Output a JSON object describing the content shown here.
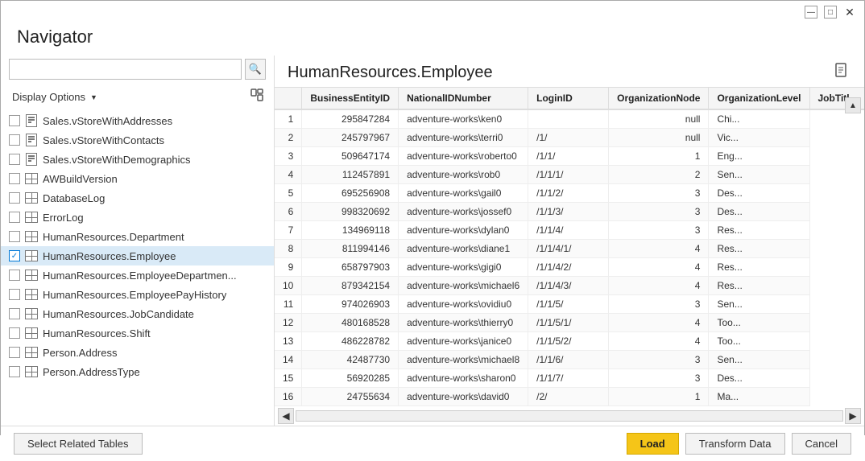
{
  "window": {
    "title": "Navigator"
  },
  "toolbar": {
    "minimize_label": "—",
    "maximize_label": "□",
    "close_label": "✕"
  },
  "left_panel": {
    "search_placeholder": "",
    "display_options_label": "Display Options",
    "display_options_chevron": "▼",
    "refresh_icon": "⟳",
    "items": [
      {
        "name": "Sales.vStoreWithAddresses",
        "type": "view",
        "checked": false
      },
      {
        "name": "Sales.vStoreWithContacts",
        "type": "view",
        "checked": false
      },
      {
        "name": "Sales.vStoreWithDemographics",
        "type": "view",
        "checked": false
      },
      {
        "name": "AWBuildVersion",
        "type": "table",
        "checked": false
      },
      {
        "name": "DatabaseLog",
        "type": "table",
        "checked": false
      },
      {
        "name": "ErrorLog",
        "type": "table",
        "checked": false
      },
      {
        "name": "HumanResources.Department",
        "type": "table",
        "checked": false
      },
      {
        "name": "HumanResources.Employee",
        "type": "table",
        "checked": true,
        "selected": true
      },
      {
        "name": "HumanResources.EmployeeDepartmen...",
        "type": "table",
        "checked": false
      },
      {
        "name": "HumanResources.EmployeePayHistory",
        "type": "table",
        "checked": false
      },
      {
        "name": "HumanResources.JobCandidate",
        "type": "table",
        "checked": false
      },
      {
        "name": "HumanResources.Shift",
        "type": "table",
        "checked": false
      },
      {
        "name": "Person.Address",
        "type": "table",
        "checked": false
      },
      {
        "name": "Person.AddressType",
        "type": "table",
        "checked": false
      }
    ]
  },
  "preview": {
    "title": "HumanResources.Employee",
    "columns": [
      "BusinessEntityID",
      "NationalIDNumber",
      "LoginID",
      "OrganizationNode",
      "OrganizationLevel",
      "JobTitl..."
    ],
    "rows": [
      {
        "num": 1,
        "id": "295847284",
        "national": "adventure-works\\ken0",
        "org_node": "",
        "org_level": "null",
        "job": "Chi..."
      },
      {
        "num": 2,
        "id": "245797967",
        "national": "adventure-works\\terri0",
        "org_node": "/1/",
        "org_level": "null",
        "job": "Vic..."
      },
      {
        "num": 3,
        "id": "509647174",
        "national": "adventure-works\\roberto0",
        "org_node": "/1/1/",
        "org_level": "1",
        "job": "Eng..."
      },
      {
        "num": 4,
        "id": "112457891",
        "national": "adventure-works\\rob0",
        "org_node": "/1/1/1/",
        "org_level": "2",
        "job": "Sen..."
      },
      {
        "num": 5,
        "id": "695256908",
        "national": "adventure-works\\gail0",
        "org_node": "/1/1/2/",
        "org_level": "3",
        "job": "Des..."
      },
      {
        "num": 6,
        "id": "998320692",
        "national": "adventure-works\\jossef0",
        "org_node": "/1/1/3/",
        "org_level": "3",
        "job": "Des..."
      },
      {
        "num": 7,
        "id": "134969118",
        "national": "adventure-works\\dylan0",
        "org_node": "/1/1/4/",
        "org_level": "3",
        "job": "Res..."
      },
      {
        "num": 8,
        "id": "811994146",
        "national": "adventure-works\\diane1",
        "org_node": "/1/1/4/1/",
        "org_level": "4",
        "job": "Res..."
      },
      {
        "num": 9,
        "id": "658797903",
        "national": "adventure-works\\gigi0",
        "org_node": "/1/1/4/2/",
        "org_level": "4",
        "job": "Res..."
      },
      {
        "num": 10,
        "id": "879342154",
        "national": "adventure-works\\michael6",
        "org_node": "/1/1/4/3/",
        "org_level": "4",
        "job": "Res..."
      },
      {
        "num": 11,
        "id": "974026903",
        "national": "adventure-works\\ovidiu0",
        "org_node": "/1/1/5/",
        "org_level": "3",
        "job": "Sen..."
      },
      {
        "num": 12,
        "id": "480168528",
        "national": "adventure-works\\thierry0",
        "org_node": "/1/1/5/1/",
        "org_level": "4",
        "job": "Too..."
      },
      {
        "num": 13,
        "id": "486228782",
        "national": "adventure-works\\janice0",
        "org_node": "/1/1/5/2/",
        "org_level": "4",
        "job": "Too..."
      },
      {
        "num": 14,
        "id": "42487730",
        "national": "adventure-works\\michael8",
        "org_node": "/1/1/6/",
        "org_level": "3",
        "job": "Sen..."
      },
      {
        "num": 15,
        "id": "56920285",
        "national": "adventure-works\\sharon0",
        "org_node": "/1/1/7/",
        "org_level": "3",
        "job": "Des..."
      },
      {
        "num": 16,
        "id": "24755634",
        "national": "adventure-works\\david0",
        "org_node": "/2/",
        "org_level": "1",
        "job": "Ma..."
      }
    ]
  },
  "bottom": {
    "select_related_label": "Select Related Tables",
    "load_label": "Load",
    "transform_label": "Transform Data",
    "cancel_label": "Cancel"
  }
}
